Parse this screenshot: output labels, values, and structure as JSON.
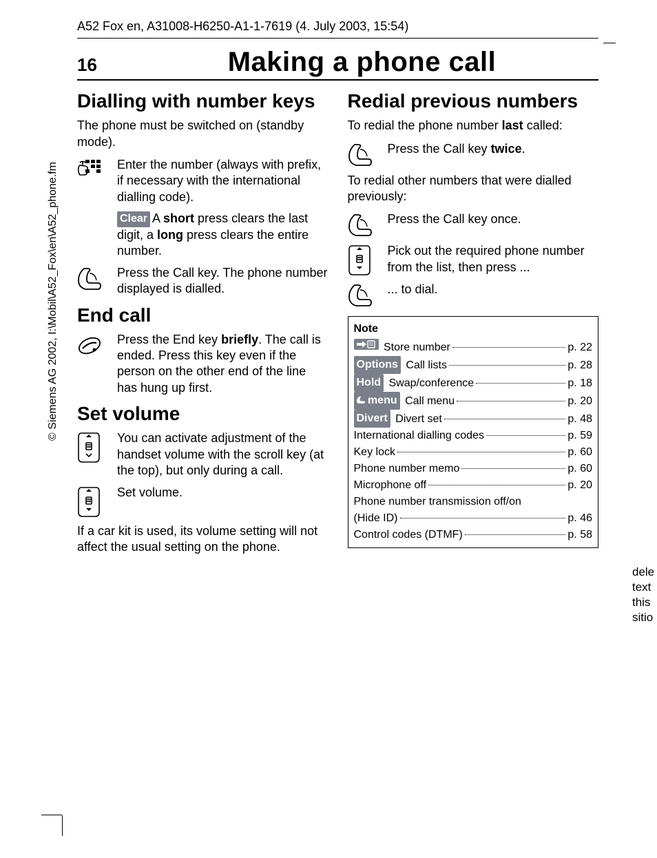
{
  "running_head": "A52 Fox en, A31008-H6250-A1-1-7619 (4. July 2003, 15:54)",
  "page_number": "16",
  "page_title": "Making a phone call",
  "col1": {
    "h_dial": "Dialling with number keys",
    "dial_intro": "The phone must be switched on (standby mode).",
    "dial_enter": "Enter the number (always with prefix, if necessary with the international dialling code).",
    "clear_label": "Clear",
    "clear_a": "A ",
    "clear_short": "short",
    "clear_mid": " press clears the last digit, a ",
    "clear_long": "long",
    "clear_end": " press clears the entire number.",
    "press_call": "Press the Call key. The phone number displayed is dialled.",
    "h_end": "End call",
    "end_a": "Press the End key ",
    "end_briefly": "briefly",
    "end_b": ". The call is ended. Press this key even if the person on the other end of the line has hung up first.",
    "h_vol": "Set volume",
    "vol_activate": "You can activate adjustment of the handset volume with the scroll key (at the top), but only during a call.",
    "vol_set": "Set volume.",
    "vol_note": "If a car kit is used, its volume setting will not affect the usual setting on the phone."
  },
  "col2": {
    "h_redial": "Redial previous numbers",
    "redial_a": "To redial the phone number ",
    "redial_last": "last",
    "redial_b": " called:",
    "press_twice_a": "Press the Call key ",
    "press_twice_b": "twice",
    "press_twice_c": ".",
    "redial_other": "To redial other numbers that were dialled previously:",
    "press_once": "Press the Call key once.",
    "pick_out": "Pick out the required phone number from the list, then press ...",
    "to_dial": "... to dial.",
    "note_title": "Note",
    "labels": {
      "options": "Options",
      "hold": "Hold",
      "call_menu": "menu",
      "divert": "Divert"
    },
    "notes": [
      {
        "label_key": "store_icon",
        "text": "Store number",
        "page": "p. 22"
      },
      {
        "label_key": "options",
        "text": "Call lists",
        "page": "p. 28"
      },
      {
        "label_key": "hold",
        "text": "Swap/conference",
        "page": "p. 18"
      },
      {
        "label_key": "call_menu",
        "text": "Call menu",
        "page": "p. 20"
      },
      {
        "label_key": "divert",
        "text": "Divert set",
        "page": "p. 48"
      },
      {
        "text": "International dialling codes",
        "page": "p. 59"
      },
      {
        "text": "Key lock",
        "page": "p. 60"
      },
      {
        "text": "Phone number memo",
        "page": "p. 60"
      },
      {
        "text": "Microphone off",
        "page": "p. 20"
      },
      {
        "text": "Phone number transmission off/on (Hide ID)",
        "page": "p. 46",
        "wrap": true
      },
      {
        "text": "Control codes (DTMF)",
        "page": "p. 58"
      }
    ]
  },
  "copyright": "© Siemens AG 2002, I:\\Mobil\\A52_Fox\\en\\A52_phone.fm",
  "marginal": [
    "dele",
    "text",
    "this",
    "sitio"
  ]
}
